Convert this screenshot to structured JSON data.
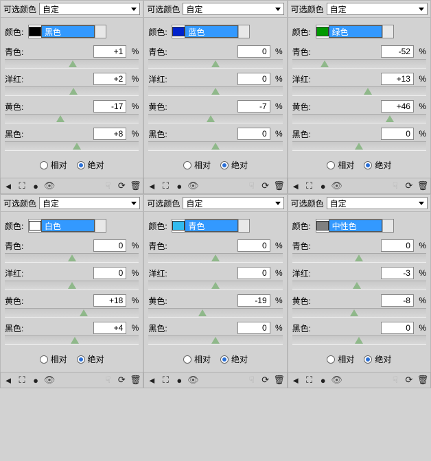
{
  "labels": {
    "selectable_color": "可选颜色",
    "custom": "自定",
    "color": "颜色:",
    "cyan": "青色:",
    "magenta": "洋红:",
    "yellow": "黄色:",
    "black": "黑色:",
    "relative": "相对",
    "absolute": "绝对",
    "pct": "%"
  },
  "panels": [
    {
      "color_name": "黑色",
      "swatch": "#000000",
      "cyan": "+1",
      "magenta": "+2",
      "yellow": "-17",
      "black": "+8",
      "mode": "absolute"
    },
    {
      "color_name": "蓝色",
      "swatch": "#0022cc",
      "cyan": "0",
      "magenta": "0",
      "yellow": "-7",
      "black": "0",
      "mode": "absolute"
    },
    {
      "color_name": "绿色",
      "swatch": "#009900",
      "cyan": "-52",
      "magenta": "+13",
      "yellow": "+46",
      "black": "0",
      "mode": "absolute"
    },
    {
      "color_name": "白色",
      "swatch": "#ffffff",
      "cyan": "0",
      "magenta": "0",
      "yellow": "+18",
      "black": "+4",
      "mode": "absolute"
    },
    {
      "color_name": "青色",
      "swatch": "#33bbee",
      "cyan": "0",
      "magenta": "0",
      "yellow": "-19",
      "black": "0",
      "mode": "absolute"
    },
    {
      "color_name": "中性色",
      "swatch": "#808080",
      "cyan": "0",
      "magenta": "-3",
      "yellow": "-8",
      "black": "0",
      "mode": "absolute"
    }
  ]
}
